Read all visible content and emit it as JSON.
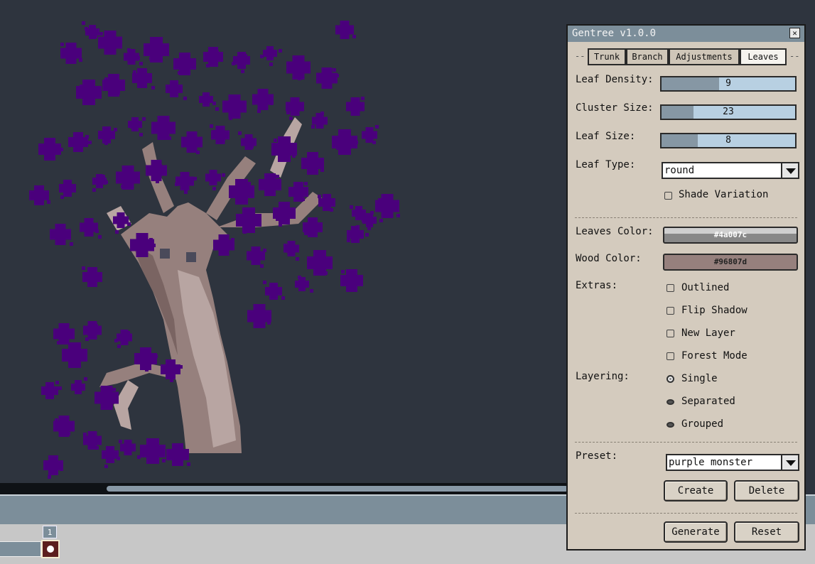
{
  "window": {
    "title": "Gentree v1.0.0",
    "close_glyph": "✕"
  },
  "tabs": [
    {
      "label": "Trunk",
      "active": false
    },
    {
      "label": "Branch",
      "active": false
    },
    {
      "label": "Adjustments",
      "active": false
    },
    {
      "label": "Leaves",
      "active": true
    }
  ],
  "sliders": {
    "leaf_density": {
      "label": "Leaf Density:",
      "value": "9",
      "fill_fraction": 0.43
    },
    "cluster_size": {
      "label": "Cluster Size:",
      "value": "23",
      "fill_fraction": 0.24
    },
    "leaf_size": {
      "label": "Leaf Size:",
      "value": "8",
      "fill_fraction": 0.27
    }
  },
  "leaf_type": {
    "label": "Leaf Type:",
    "value": "round"
  },
  "shade_variation": {
    "label": "Shade Variation",
    "checked": false
  },
  "leaves_color": {
    "label": "Leaves Color:",
    "hex": "#4a007c"
  },
  "wood_color": {
    "label": "Wood Color:",
    "hex": "#96807d"
  },
  "extras": {
    "label": "Extras:",
    "options": [
      {
        "label": "Outlined",
        "checked": false
      },
      {
        "label": "Flip Shadow",
        "checked": false
      },
      {
        "label": "New Layer",
        "checked": false
      },
      {
        "label": "Forest Mode",
        "checked": false
      }
    ]
  },
  "layering": {
    "label": "Layering:",
    "options": [
      {
        "label": "Single",
        "selected": true
      },
      {
        "label": "Separated",
        "selected": false
      },
      {
        "label": "Grouped",
        "selected": false
      }
    ]
  },
  "preset": {
    "label": "Preset:",
    "value": "purple monster"
  },
  "buttons": {
    "create": "Create",
    "delete": "Delete",
    "generate": "Generate",
    "reset": "Reset"
  },
  "timeline": {
    "frame_number": "1"
  },
  "colors": {
    "canvas_bg": "#2e343e",
    "leaf": "#4a007c",
    "wood": "#96807d",
    "panel_bg": "#d4cbbe",
    "titlebar": "#7c8e9a"
  }
}
